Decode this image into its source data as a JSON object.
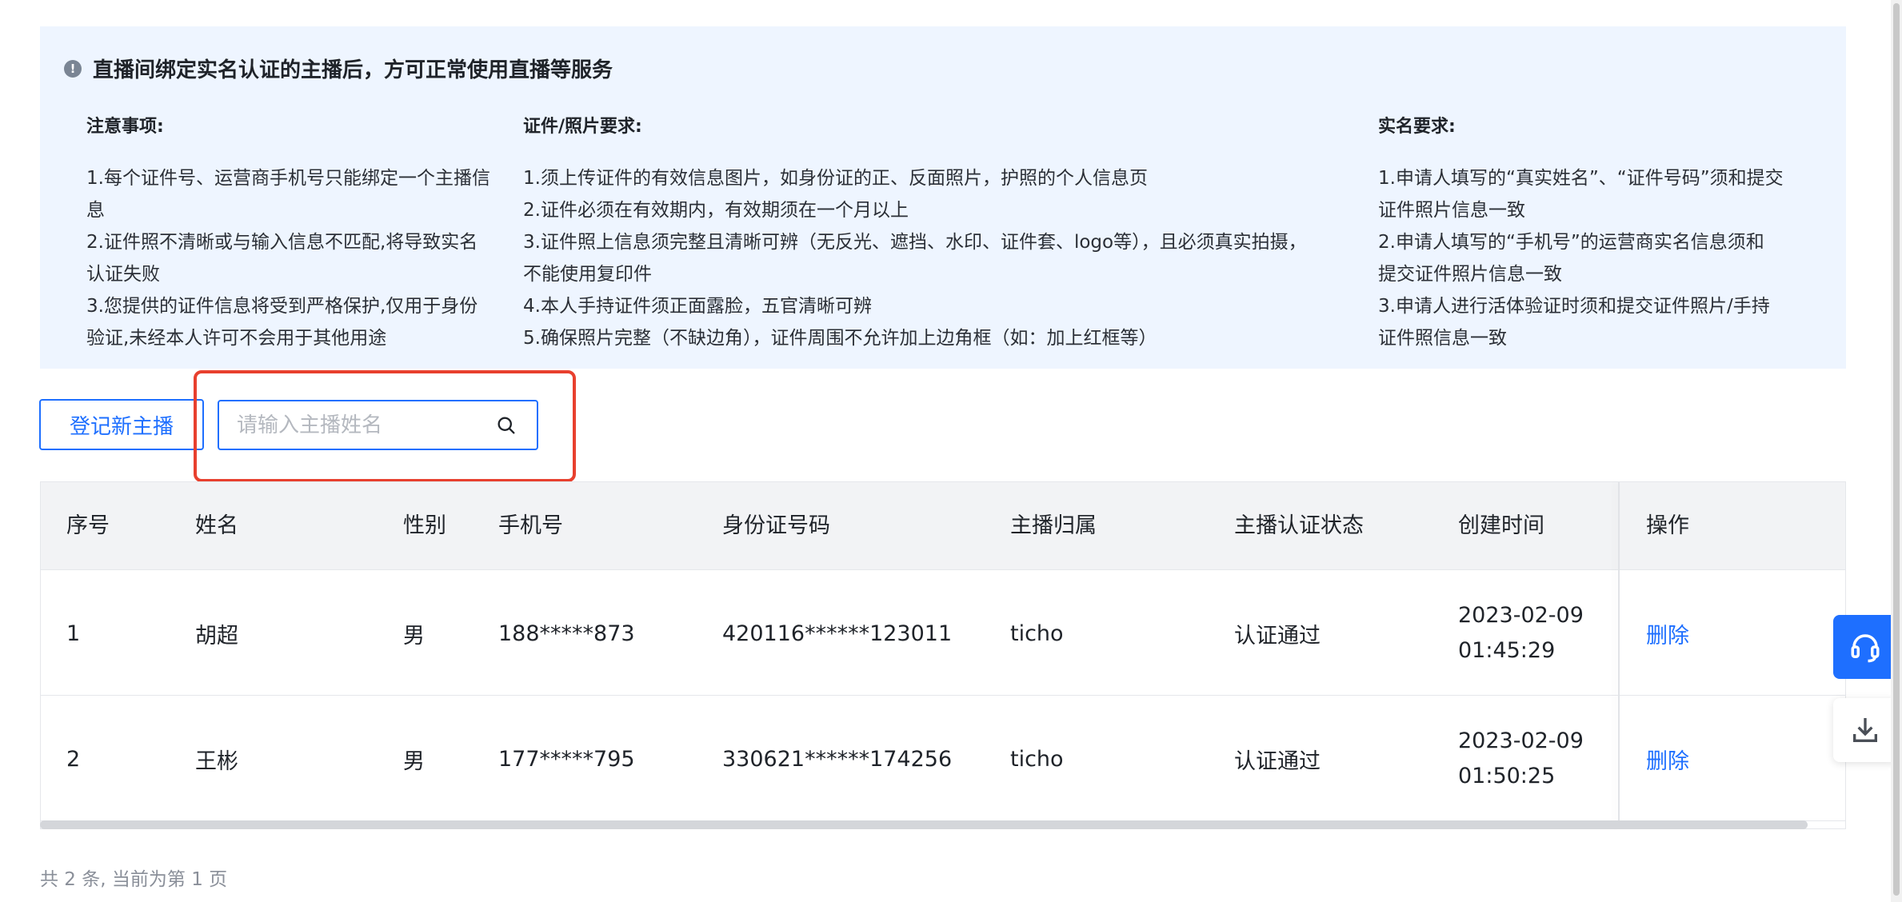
{
  "notice": {
    "title": "直播间绑定实名认证的主播后，方可正常使用直播等服务",
    "columns": [
      {
        "heading": "注意事项:",
        "lines": [
          "1.每个证件号、运营商手机号只能绑定一个主播信",
          "息",
          "2.证件照不清晰或与输入信息不匹配,将导致实名",
          "认证失败",
          "3.您提供的证件信息将受到严格保护,仅用于身份",
          "验证,未经本人许可不会用于其他用途"
        ]
      },
      {
        "heading": "证件/照片要求:",
        "lines": [
          "1.须上传证件的有效信息图片，如身份证的正、反面照片，护照的个人信息页",
          "2.证件必须在有效期内，有效期须在一个月以上",
          "3.证件照上信息须完整且清晰可辨（无反光、遮挡、水印、证件套、logo等），且必须真实拍摄，",
          "不能使用复印件",
          "4.本人手持证件须正面露脸，五官清晰可辨",
          "5.确保照片完整（不缺边角），证件周围不允许加上边角框（如：加上红框等）"
        ]
      },
      {
        "heading": "实名要求:",
        "lines": [
          "1.申请人填写的“真实姓名”、“证件号码”须和提交",
          "证件照片信息一致",
          "2.申请人填写的“手机号”的运营商实名信息须和",
          "提交证件照片信息一致",
          "3.申请人进行活体验证时须和提交证件照片/手持",
          "证件照信息一致"
        ]
      }
    ]
  },
  "toolbar": {
    "register_label": "登记新主播",
    "search_placeholder": "请输入主播姓名",
    "search_value": ""
  },
  "table": {
    "headers": [
      "序号",
      "姓名",
      "性别",
      "手机号",
      "身份证号码",
      "主播归属",
      "主播认证状态",
      "创建时间",
      "操作"
    ],
    "rows": [
      {
        "index": "1",
        "name": "胡超",
        "gender": "男",
        "phone": "188*****873",
        "id_number": "420116******123011",
        "owner": "ticho",
        "status": "认证通过",
        "created_date": "2023-02-09",
        "created_time": "01:45:29",
        "action": "删除"
      },
      {
        "index": "2",
        "name": "王彬",
        "gender": "男",
        "phone": "177*****795",
        "id_number": "330621******174256",
        "owner": "ticho",
        "status": "认证通过",
        "created_date": "2023-02-09",
        "created_time": "01:50:25",
        "action": "删除"
      }
    ]
  },
  "pagination": {
    "summary": "共 2 条, 当前为第 1 页"
  },
  "float_tools": [
    {
      "icon": "headset-icon"
    },
    {
      "icon": "download-icon"
    }
  ],
  "colors": {
    "accent": "#1e6fff",
    "highlight": "#e8402e",
    "notice_bg": "#eef5ff"
  }
}
